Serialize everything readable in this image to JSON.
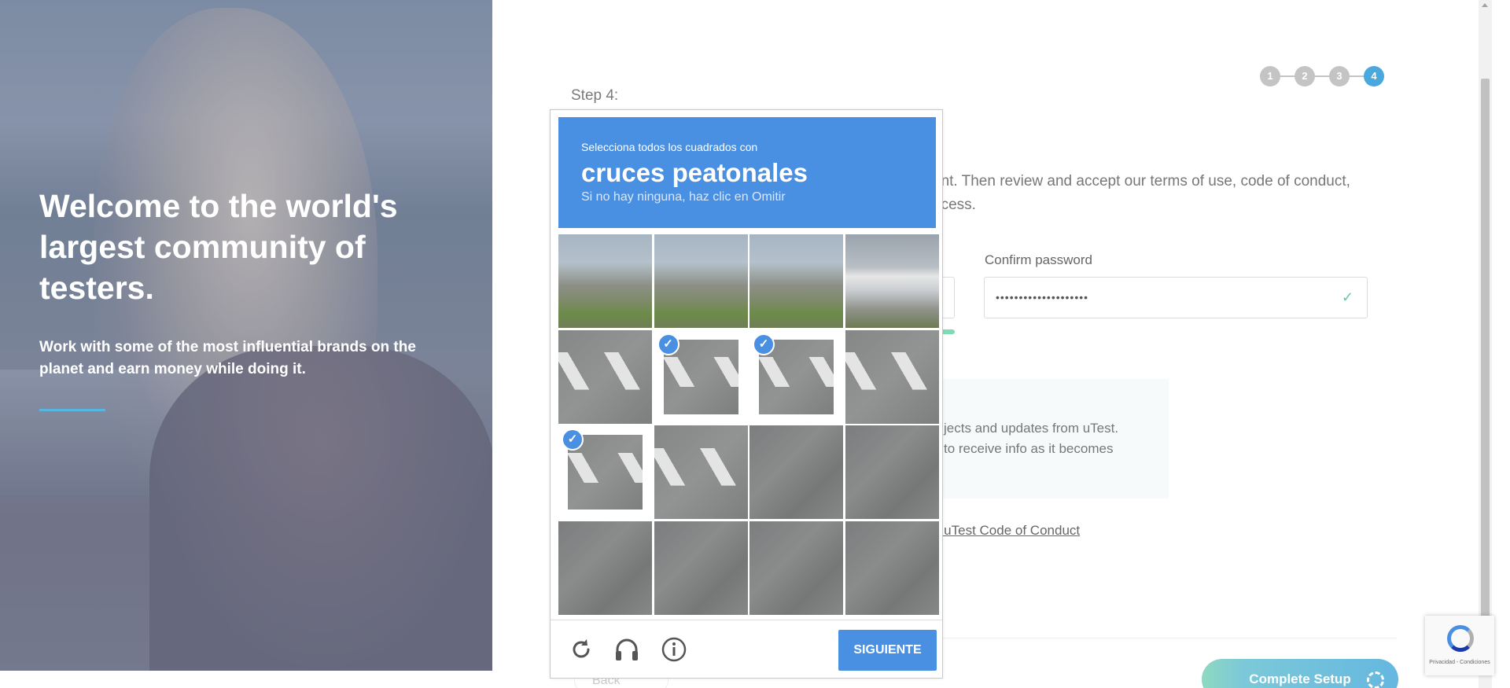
{
  "hero": {
    "title": "Welcome to the world's largest community of testers.",
    "subtitle": "Work with some of the most influential brands on the planet and earn money while doing it."
  },
  "form": {
    "step_label": "Step 4:",
    "steps": [
      "1",
      "2",
      "3",
      "4"
    ],
    "active_step": 4,
    "intro_line1": "unt. Then review and accept our terms of use, code of conduct,",
    "intro_line2": "ocess.",
    "confirm_password_label": "Confirm password",
    "confirm_password_value": "••••••••••••••••••••",
    "newsletter_line1": "jects and updates from uTest.",
    "newsletter_line2": "to receive info as it becomes",
    "code_of_conduct_link": "e uTest Code of Conduct",
    "back_label": "Back",
    "complete_label": "Complete Setup"
  },
  "captcha": {
    "instruction": "Selecciona todos los cuadrados con",
    "target": "cruces peatonales",
    "hint": "Si no hay ninguna, haz clic en Omitir",
    "next_label": "SIGUIENTE",
    "accent_color": "#4a90e2",
    "tiles": [
      {
        "row": 1,
        "col": 1,
        "scene": "street",
        "selected": false
      },
      {
        "row": 1,
        "col": 2,
        "scene": "street",
        "selected": false
      },
      {
        "row": 1,
        "col": 3,
        "scene": "street",
        "selected": false
      },
      {
        "row": 1,
        "col": 4,
        "scene": "sign",
        "selected": false
      },
      {
        "row": 2,
        "col": 1,
        "scene": "crosswalk",
        "selected": false
      },
      {
        "row": 2,
        "col": 2,
        "scene": "crosswalk",
        "selected": true
      },
      {
        "row": 2,
        "col": 3,
        "scene": "crosswalk",
        "selected": true
      },
      {
        "row": 2,
        "col": 4,
        "scene": "crosswalk",
        "selected": false
      },
      {
        "row": 3,
        "col": 1,
        "scene": "crosswalk",
        "selected": true
      },
      {
        "row": 3,
        "col": 2,
        "scene": "crosswalk",
        "selected": false
      },
      {
        "row": 3,
        "col": 3,
        "scene": "road",
        "selected": false
      },
      {
        "row": 3,
        "col": 4,
        "scene": "road",
        "selected": false
      },
      {
        "row": 4,
        "col": 1,
        "scene": "road",
        "selected": false
      },
      {
        "row": 4,
        "col": 2,
        "scene": "road",
        "selected": false
      },
      {
        "row": 4,
        "col": 3,
        "scene": "road",
        "selected": false
      },
      {
        "row": 4,
        "col": 4,
        "scene": "road",
        "selected": false
      }
    ],
    "icons": [
      "reload-icon",
      "audio-icon",
      "info-icon"
    ]
  },
  "recaptcha_badge": {
    "text": "Privacidad - Condiciones"
  },
  "colors": {
    "accent_blue": "#4a90e2",
    "step_active": "#4aa8dd",
    "check_green": "#5ccf9b"
  }
}
